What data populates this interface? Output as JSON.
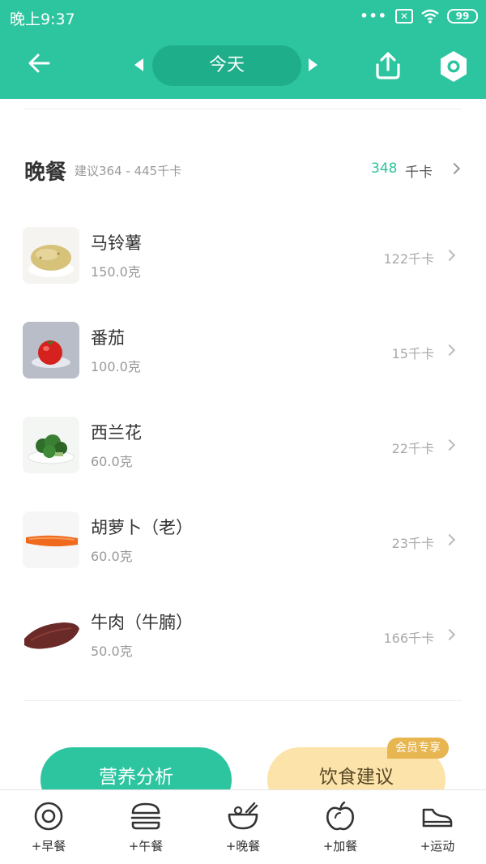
{
  "status": {
    "time": "晚上9:37",
    "battery": "99"
  },
  "nav": {
    "date_label": "今天"
  },
  "meal": {
    "title": "晚餐",
    "suggestion": "建议364 - 445千卡",
    "kcal": "348",
    "unit": "千卡"
  },
  "foods": [
    {
      "name": "马铃薯",
      "weight": "150.0克",
      "kcal": "122千卡",
      "icon": "potato-icon"
    },
    {
      "name": "番茄",
      "weight": "100.0克",
      "kcal": "15千卡",
      "icon": "tomato-icon"
    },
    {
      "name": "西兰花",
      "weight": "60.0克",
      "kcal": "22千卡",
      "icon": "broccoli-icon"
    },
    {
      "name": "胡萝卜（老）",
      "weight": "60.0克",
      "kcal": "23千卡",
      "icon": "carrot-icon"
    },
    {
      "name": "牛肉（牛腩）",
      "weight": "50.0克",
      "kcal": "166千卡",
      "icon": "beef-icon"
    }
  ],
  "buttons": {
    "analysis": "营养分析",
    "advice": "饮食建议",
    "vip_badge": "会员专享"
  },
  "tabs": [
    {
      "label": "+早餐",
      "icon": "egg-icon"
    },
    {
      "label": "+午餐",
      "icon": "burger-icon"
    },
    {
      "label": "+晚餐",
      "icon": "bowl-icon"
    },
    {
      "label": "+加餐",
      "icon": "apple-icon"
    },
    {
      "label": "+运动",
      "icon": "shoe-icon"
    }
  ],
  "colors": {
    "accent": "#2cc59f",
    "accent_dark": "#1fae8a",
    "vip": "#e8b650",
    "advice_bg": "#fbe3a9"
  }
}
